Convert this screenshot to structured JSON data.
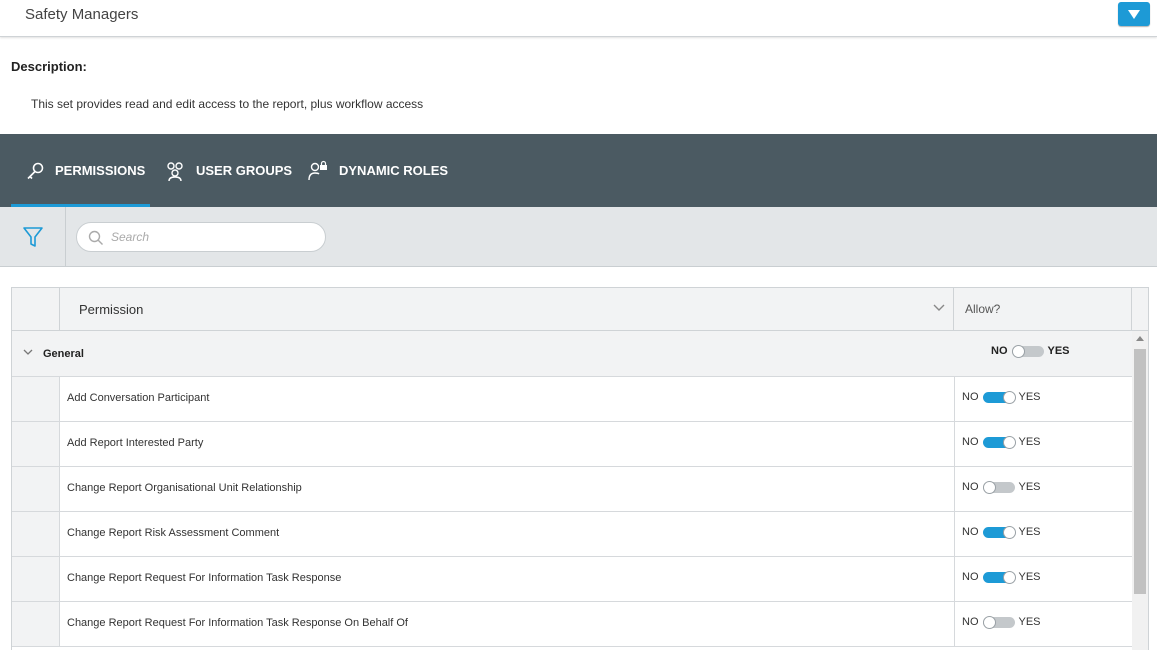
{
  "header": {
    "title": "Safety Managers",
    "menu_icon": "caret-down-icon"
  },
  "description": {
    "label": "Description:",
    "text": "This set provides read and edit access to the report, plus workflow access"
  },
  "tabs": [
    {
      "label": "PERMISSIONS",
      "icon": "key-icon",
      "active": true
    },
    {
      "label": "USER GROUPS",
      "icon": "user-group-icon",
      "active": false
    },
    {
      "label": "DYNAMIC ROLES",
      "icon": "user-lock-icon",
      "active": false
    }
  ],
  "search": {
    "placeholder": "Search",
    "value": ""
  },
  "grid": {
    "columns": {
      "permission": "Permission",
      "allow": "Allow?"
    },
    "group": {
      "label": "General",
      "no": "NO",
      "yes": "YES",
      "allowed": false
    },
    "rows": [
      {
        "name": "Add Conversation Participant",
        "allowed": true
      },
      {
        "name": "Add Report Interested Party",
        "allowed": true
      },
      {
        "name": "Change Report Organisational Unit Relationship",
        "allowed": false
      },
      {
        "name": "Change Report Risk Assessment Comment",
        "allowed": true
      },
      {
        "name": "Change Report Request For Information Task Response",
        "allowed": true
      },
      {
        "name": "Change Report Request For Information Task Response On Behalf Of",
        "allowed": false
      }
    ],
    "no_label": "NO",
    "yes_label": "YES"
  },
  "colors": {
    "accent": "#1d9ad6",
    "tabbar": "#4b5a62",
    "toolbar": "#e3e6e8"
  }
}
